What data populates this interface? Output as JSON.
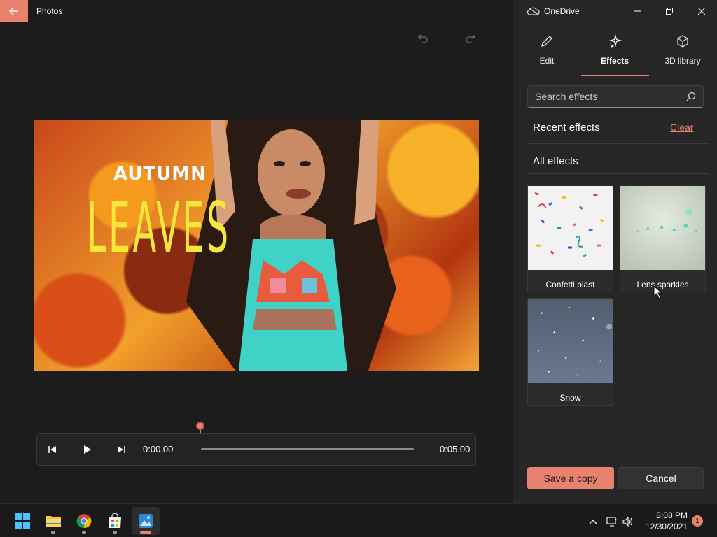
{
  "titlebar": {
    "app_title": "Photos"
  },
  "video": {
    "overlay_title": "AUTUMN",
    "overlay_subtitle": "LEAVES"
  },
  "playback": {
    "current_time": "0:00.00",
    "end_time": "0:05.00",
    "progress": 0.0
  },
  "panel": {
    "cloud_label": "OneDrive",
    "tabs": [
      {
        "label": "Edit",
        "icon": "pencil-icon"
      },
      {
        "label": "Effects",
        "icon": "sparkles-icon",
        "active": true
      },
      {
        "label": "3D library",
        "icon": "cube-icon"
      }
    ],
    "search": {
      "placeholder": "Search effects"
    },
    "recent_heading": "Recent effects",
    "clear_label": "Clear",
    "all_heading": "All effects",
    "effects": [
      {
        "label": "Confetti blast"
      },
      {
        "label": "Lens sparkles"
      },
      {
        "label": "Snow"
      }
    ],
    "save_label": "Save a copy",
    "cancel_label": "Cancel"
  },
  "taskbar": {
    "time": "8:08 PM",
    "date": "12/30/2021",
    "notification_count": "1"
  },
  "colors": {
    "accent": "#e8826f",
    "background": "#1c1c1c",
    "panel": "#262626"
  }
}
